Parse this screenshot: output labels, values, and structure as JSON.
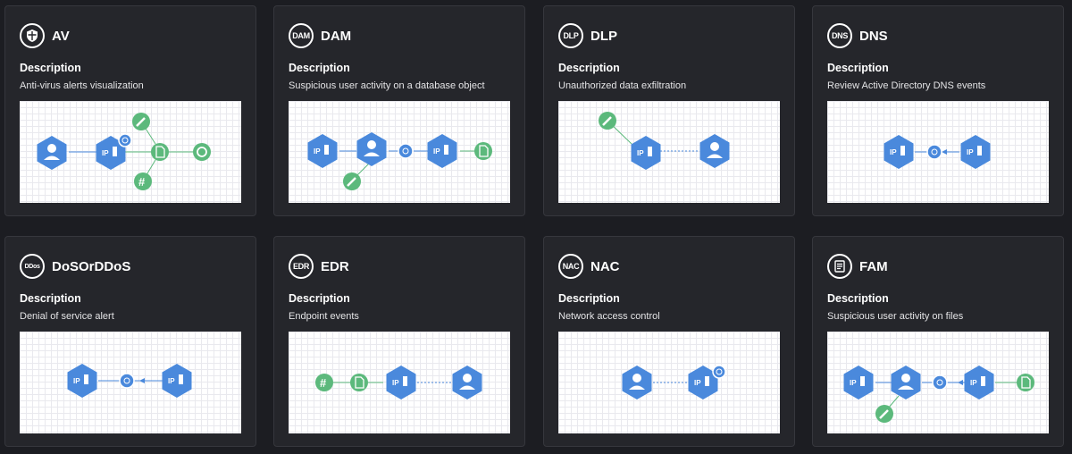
{
  "description_label": "Description",
  "colors": {
    "background": "#1c1d22",
    "card": "#25262b",
    "node_blue": "#4a89dc",
    "node_green": "#5cb97c"
  },
  "node_text": {
    "ip": "IP",
    "hash": "#"
  },
  "cards": [
    {
      "title": "AV",
      "badge_icon": "shield-icon",
      "description": "Anti-virus alerts visualization"
    },
    {
      "title": "DAM",
      "badge_text": "DAM",
      "description": "Suspicious user activity on a database object"
    },
    {
      "title": "DLP",
      "badge_text": "DLP",
      "description": "Unauthorized data exfiltration"
    },
    {
      "title": "DNS",
      "badge_text": "DNS",
      "description": "Review Active Directory DNS events"
    },
    {
      "title": "DoSOrDDoS",
      "badge_text": "DDos",
      "description": "Denial of service alert"
    },
    {
      "title": "EDR",
      "badge_text": "EDR",
      "description": "Endpoint events"
    },
    {
      "title": "NAC",
      "badge_text": "NAC",
      "description": "Network access control"
    },
    {
      "title": "FAM",
      "badge_icon": "document-list-icon",
      "description": "Suspicious user activity on files"
    }
  ]
}
